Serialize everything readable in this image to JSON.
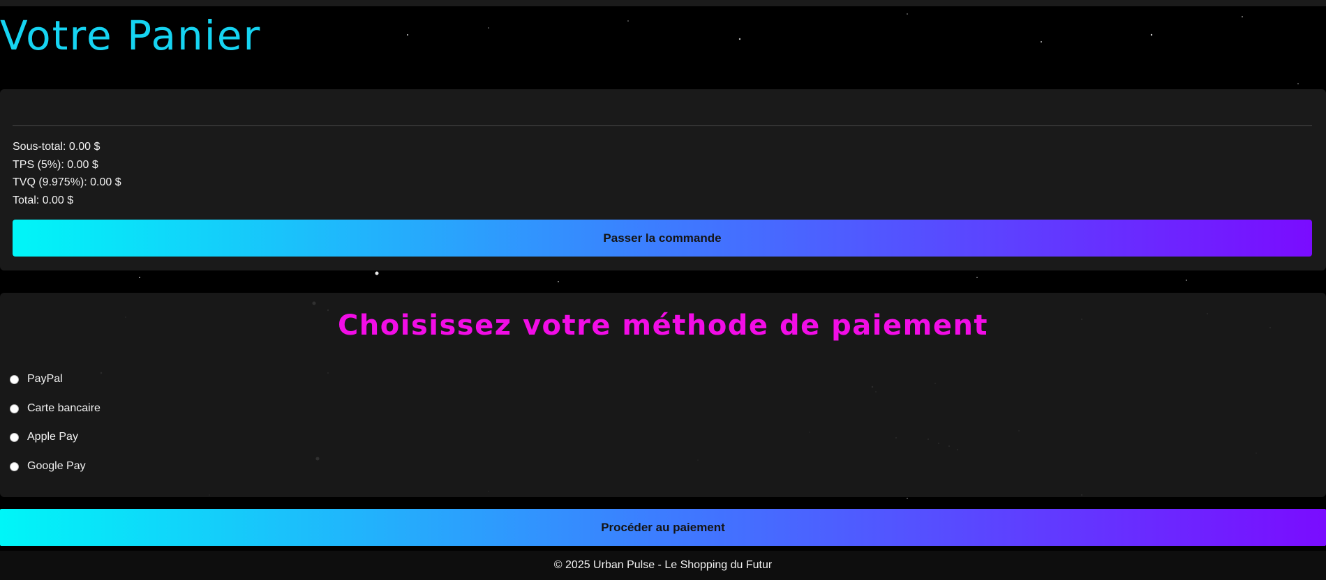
{
  "header": {
    "title": "Votre Panier"
  },
  "cart": {
    "subtotal_label": "Sous-total: 0.00 $",
    "tps_label": "TPS (5%): 0.00 $",
    "tvq_label": "TVQ (9.975%): 0.00 $",
    "total_label": "Total: 0.00 $",
    "checkout_button": "Passer la commande"
  },
  "payment": {
    "title": "Choisissez votre méthode de paiement",
    "options": [
      {
        "label": "PayPal"
      },
      {
        "label": "Carte bancaire"
      },
      {
        "label": "Apple Pay"
      },
      {
        "label": "Google Pay"
      }
    ],
    "proceed_button": "Procéder au paiement"
  },
  "footer": {
    "text": "© 2025 Urban Pulse - Le Shopping du Futur"
  },
  "colors": {
    "title": "#16d4f2",
    "payment_title": "#f20de6",
    "gradient_start": "#00f6f8",
    "gradient_end": "#7a0cff"
  }
}
